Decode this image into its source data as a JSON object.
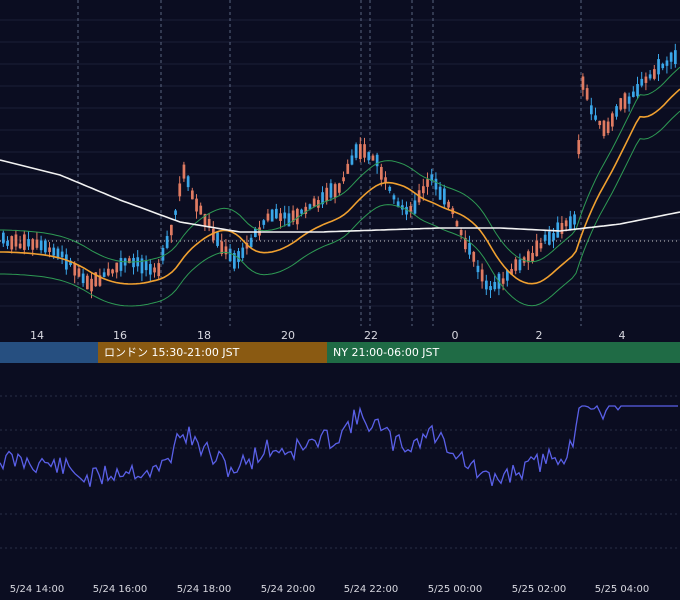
{
  "main_axis_labels": [
    {
      "label": "14",
      "index": 0
    },
    {
      "label": "16",
      "index": 1
    },
    {
      "label": "18",
      "index": 2
    },
    {
      "label": "20",
      "index": 3
    },
    {
      "label": "22",
      "index": 4
    },
    {
      "label": "0",
      "index": 5
    },
    {
      "label": "2",
      "index": 6
    },
    {
      "label": "4",
      "index": 7
    }
  ],
  "sessions": [
    {
      "label": "",
      "color": "#264f80"
    },
    {
      "label": "ロンドン 15:30-21:00 JST",
      "color": "#8a5a12"
    },
    {
      "label": "NY 21:00-06:00 JST",
      "color": "#1f6b45"
    }
  ],
  "bottom_axis_labels": [
    {
      "label": "5/24 14:00"
    },
    {
      "label": "5/24 16:00"
    },
    {
      "label": "5/24 18:00"
    },
    {
      "label": "5/24 20:00"
    },
    {
      "label": "5/24 22:00"
    },
    {
      "label": "5/25 00:00"
    },
    {
      "label": "5/25 02:00"
    },
    {
      "label": "5/25 04:00"
    }
  ],
  "colors": {
    "background": "#0b0d21",
    "candle_up": "#3aa6e8",
    "candle_down": "#e07b62",
    "ma_short": "#f0a030",
    "ma_long": "#f2f2f2",
    "bollinger": "#2e9a54",
    "oscillator": "#5a60e8",
    "grid": "#2a2e48"
  },
  "chart_data": {
    "type": "candlestick",
    "x_axis_times": [
      "5/24 14:00",
      "5/24 16:00",
      "5/24 18:00",
      "5/24 20:00",
      "5/24 22:00",
      "5/25 00:00",
      "5/25 02:00",
      "5/25 04:00"
    ],
    "overlays": [
      "moving average (orange)",
      "moving average (white)",
      "bollinger bands (green)"
    ],
    "sub_indicator": "oscillator line (blue)",
    "grid": true
  }
}
